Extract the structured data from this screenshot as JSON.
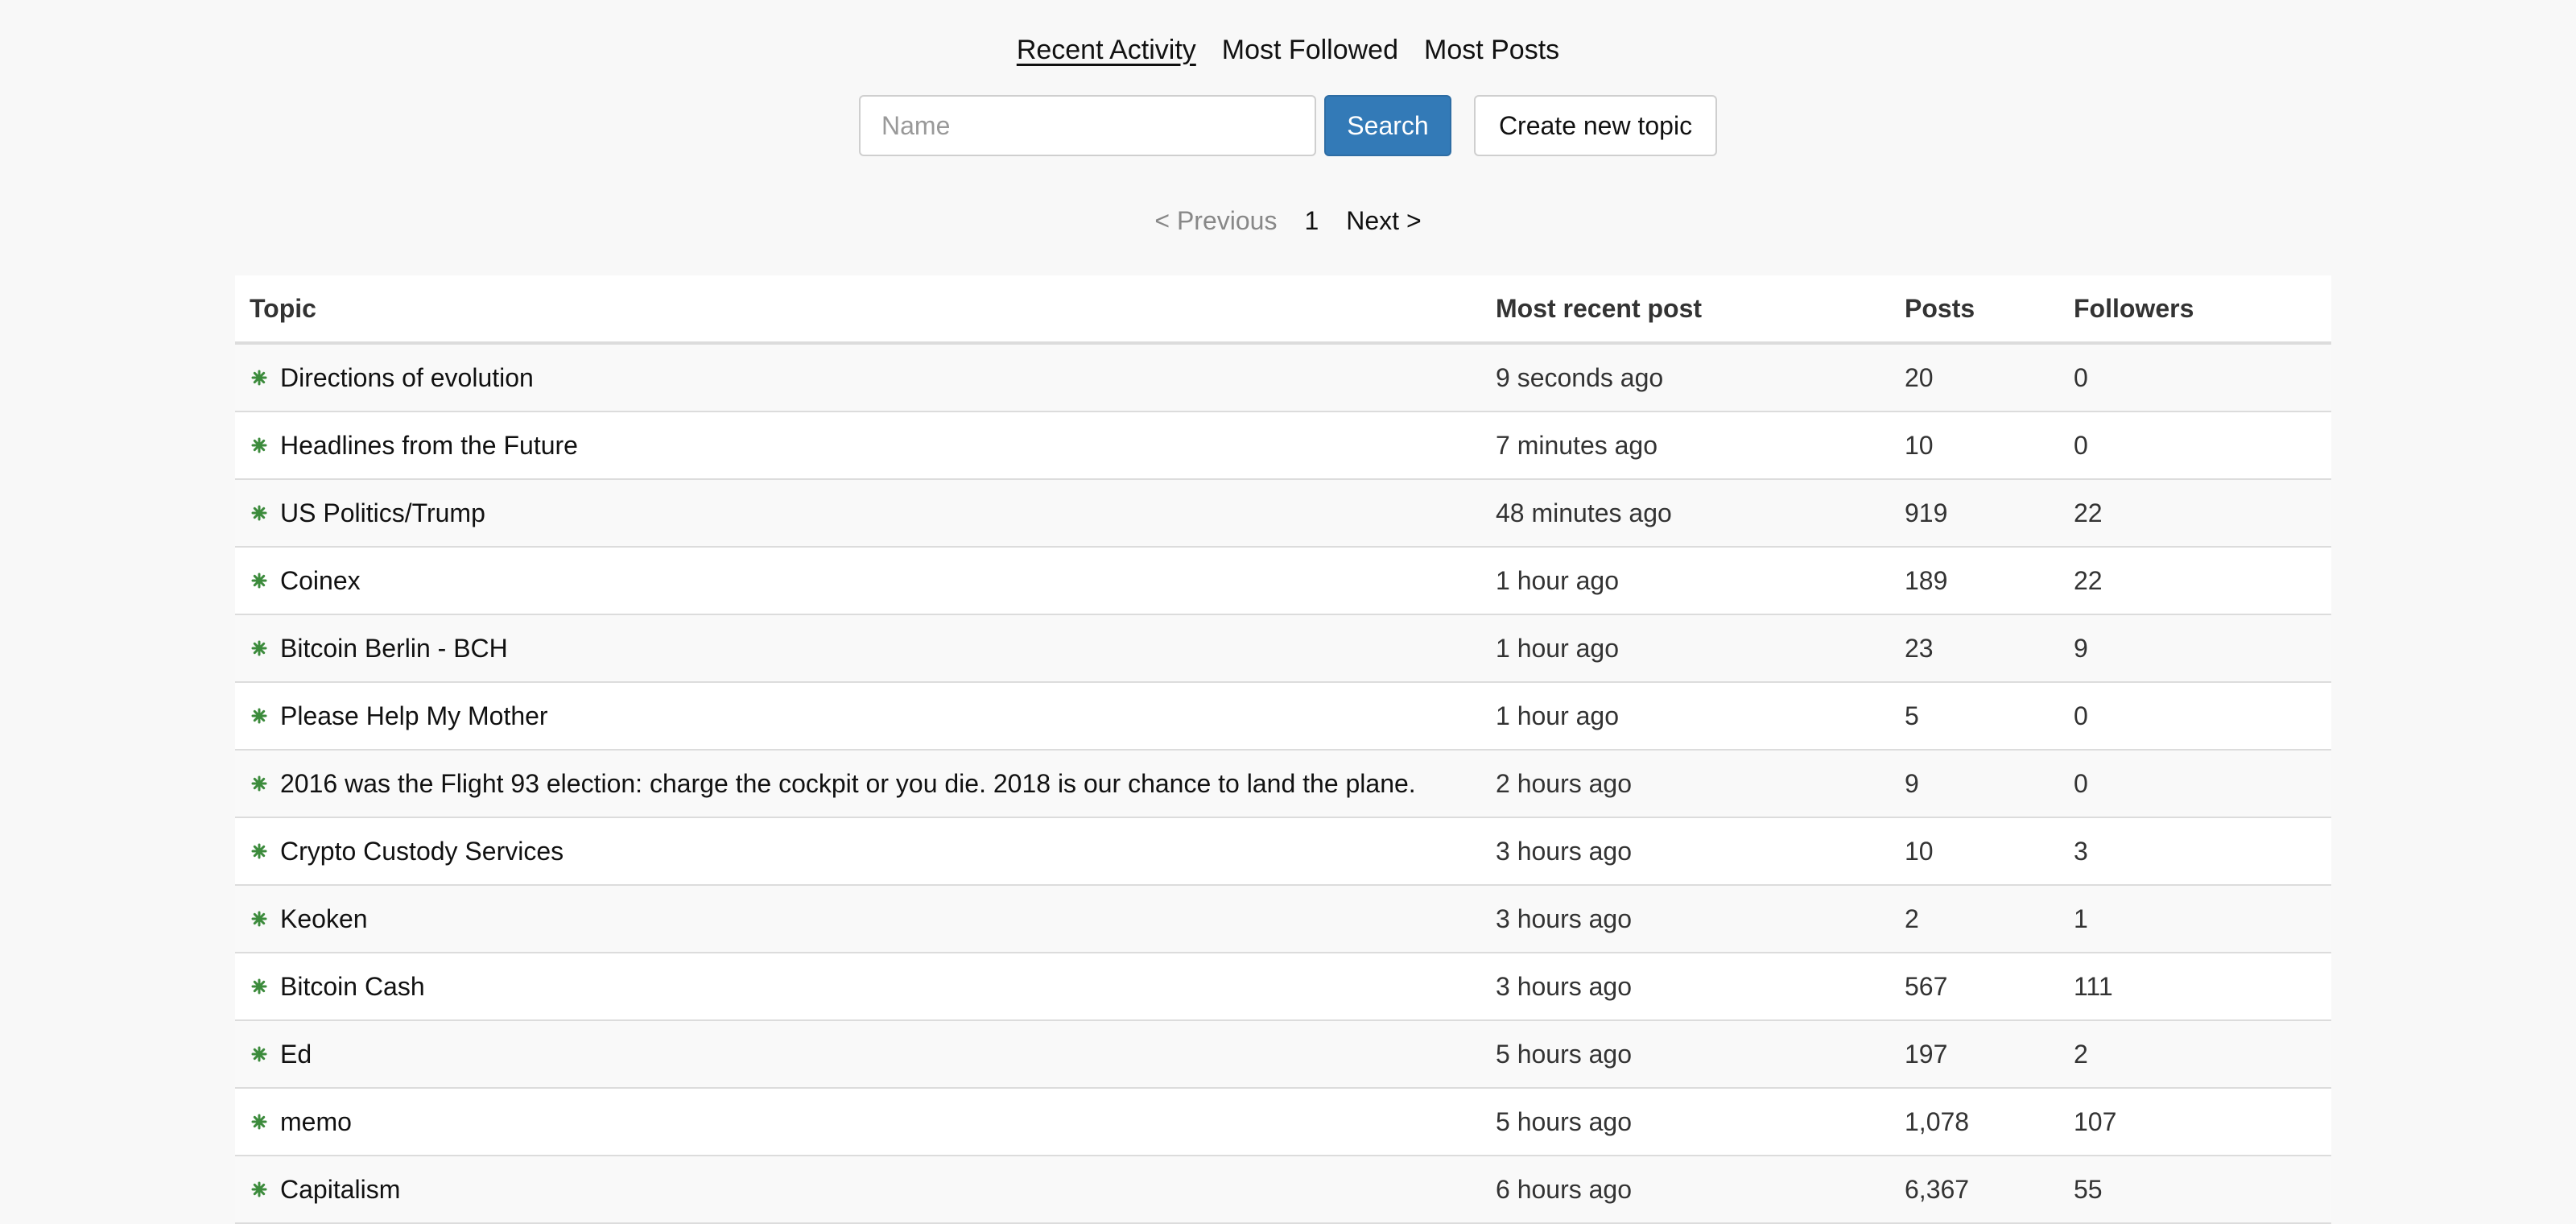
{
  "tabs": [
    {
      "label": "Recent Activity",
      "active": true
    },
    {
      "label": "Most Followed",
      "active": false
    },
    {
      "label": "Most Posts",
      "active": false
    }
  ],
  "search": {
    "placeholder": "Name",
    "value": "",
    "button_label": "Search",
    "create_label": "Create new topic"
  },
  "pager": {
    "prev_label": "< Previous",
    "page": "1",
    "next_label": "Next >"
  },
  "table": {
    "headers": {
      "topic": "Topic",
      "recent": "Most recent post",
      "posts": "Posts",
      "followers": "Followers"
    },
    "icon": "topic-icon",
    "icon_color": "#3c8b3c",
    "rows": [
      {
        "topic": "Directions of evolution",
        "recent": "9 seconds ago",
        "posts": "20",
        "followers": "0"
      },
      {
        "topic": "Headlines from the Future",
        "recent": "7 minutes ago",
        "posts": "10",
        "followers": "0"
      },
      {
        "topic": "US Politics/Trump",
        "recent": "48 minutes ago",
        "posts": "919",
        "followers": "22"
      },
      {
        "topic": "Coinex",
        "recent": "1 hour ago",
        "posts": "189",
        "followers": "22"
      },
      {
        "topic": "Bitcoin Berlin - BCH",
        "recent": "1 hour ago",
        "posts": "23",
        "followers": "9"
      },
      {
        "topic": "Please Help My Mother",
        "recent": "1 hour ago",
        "posts": "5",
        "followers": "0"
      },
      {
        "topic": "2016 was the Flight 93 election: charge the cockpit or you die. 2018 is our chance to land the plane.",
        "recent": "2 hours ago",
        "posts": "9",
        "followers": "0"
      },
      {
        "topic": "Crypto Custody Services",
        "recent": "3 hours ago",
        "posts": "10",
        "followers": "3"
      },
      {
        "topic": "Keoken",
        "recent": "3 hours ago",
        "posts": "2",
        "followers": "1"
      },
      {
        "topic": "Bitcoin Cash",
        "recent": "3 hours ago",
        "posts": "567",
        "followers": "111"
      },
      {
        "topic": "Ed",
        "recent": "5 hours ago",
        "posts": "197",
        "followers": "2"
      },
      {
        "topic": "memo",
        "recent": "5 hours ago",
        "posts": "1,078",
        "followers": "107"
      },
      {
        "topic": "Capitalism",
        "recent": "6 hours ago",
        "posts": "6,367",
        "followers": "55"
      }
    ]
  }
}
